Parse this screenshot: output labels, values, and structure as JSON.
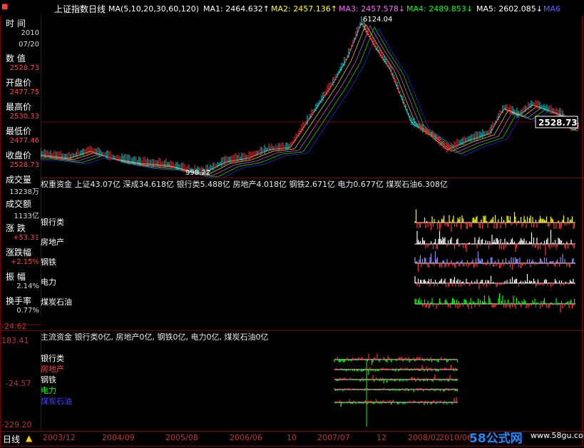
{
  "header": {
    "title": "上证指数日线",
    "ma_params": "MA(5,10,20,30,60,120)",
    "ma1": "MA1: 2464.632↑",
    "ma2": "MA2: 2457.136↑",
    "ma3": "MA3: 2457.578↓",
    "ma4": "MA4: 2489.853↓",
    "ma5": "MA5: 2602.085↓",
    "extra": "MA6"
  },
  "left_panel": [
    {
      "label": "时 间",
      "values": [
        "2010",
        "07/20"
      ]
    },
    {
      "label": "数 值",
      "values": [
        "2528.73"
      ]
    },
    {
      "label": "开盘价",
      "values": [
        "2477.75"
      ]
    },
    {
      "label": "最高价",
      "values": [
        "2530.33"
      ]
    },
    {
      "label": "最低价",
      "values": [
        "2477.46"
      ]
    },
    {
      "label": "收盘价",
      "values": [
        "2528.73"
      ]
    },
    {
      "label": "成交量",
      "values": [
        "13238万"
      ]
    },
    {
      "label": "成交额",
      "values": [
        "1133亿"
      ]
    },
    {
      "label": "涨 跌",
      "values": [
        "+53.31"
      ]
    },
    {
      "label": "涨跌幅",
      "values": [
        "+2.15%"
      ]
    },
    {
      "label": "振 幅",
      "values": [
        "2.14%"
      ]
    },
    {
      "label": "换手率",
      "values": [
        "0.77%"
      ]
    }
  ],
  "main_chart": {
    "low_label": "998.22",
    "high_label": "6124.04",
    "current_price": "2528.73"
  },
  "panel2": {
    "title": "权重资金",
    "summary": "上证43.07亿 深成34.618亿 银行类5.488亿 房地产4.018亿 钢铁2.671亿 电力0.677亿 煤炭石油6.308亿",
    "rows": [
      "银行类",
      "房地产",
      "钢铁",
      "电力",
      "煤炭石油"
    ],
    "axis_value": "-24.62"
  },
  "panel3": {
    "title": "主流资金",
    "summary": "银行类0亿, 房地产0亿, 钢铁0亿, 电力0亿, 煤炭石油0亿",
    "rows": [
      "银行类",
      "房地产",
      "钢铁",
      "电力",
      "煤炭石油"
    ],
    "axis_top": "183.41",
    "axis_mid": "-24.57",
    "axis_bottom": "-229.20"
  },
  "bottom": {
    "period": "日线",
    "dates": [
      "2003/12",
      "2004/09",
      "2005/08",
      "2006/06",
      "10",
      "2007/07",
      "12",
      "2008/02",
      "2010/06"
    ]
  },
  "watermark": {
    "logo": "58公式网",
    "url": "www.58gu.com"
  },
  "colors": {
    "up": "#ff3030",
    "down": "#00ffff",
    "frame": "#7a0000",
    "yellow": "#ffff00",
    "green": "#00ff00",
    "lavender": "#9090ff"
  }
}
